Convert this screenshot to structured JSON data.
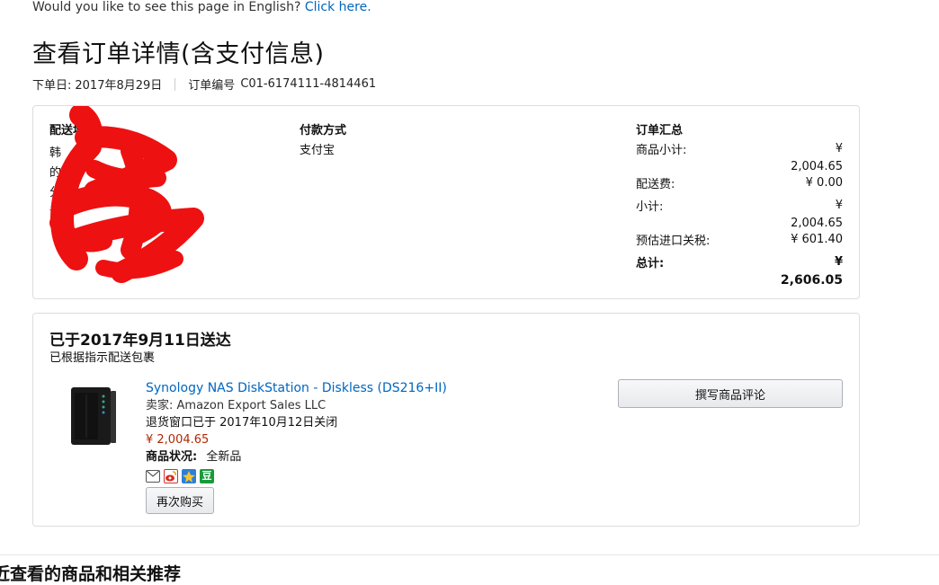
{
  "lang_prompt": {
    "question": "Would you like to see this page in English?",
    "link": "Click here."
  },
  "page_title": "查看订单详情(含支付信息)",
  "order_meta": {
    "date_label": "下单日:",
    "date": "2017年8月29日",
    "order_no_label": "订单编号",
    "order_no": "C01-6174111-4814461"
  },
  "shipping": {
    "title": "配送地",
    "lines": [
      "韩",
      "",
      "",
      "",
      "的",
      "分证",
      "证"
    ]
  },
  "payment": {
    "title": "付款方式",
    "method": "支付宝"
  },
  "summary": {
    "title": "订单汇总",
    "rows": [
      {
        "label": "商品小计:",
        "value_line1": "¥",
        "value_line2": "2,004.65"
      },
      {
        "label": "配送费:",
        "value_line1": "¥ 0.00",
        "value_line2": ""
      },
      {
        "label": "小计:",
        "value_line1": "¥",
        "value_line2": "2,004.65"
      },
      {
        "label": "预估进口关税:",
        "value_line1": "¥ 601.40",
        "value_line2": ""
      },
      {
        "label": "总计:",
        "value_line1": "¥",
        "value_line2": "2,606.05"
      }
    ]
  },
  "delivery": {
    "title": "已于2017年9月11日送达",
    "subtitle": "已根据指示配送包裹"
  },
  "item": {
    "title": "Synology NAS DiskStation - Diskless (DS216+II)",
    "seller": "卖家: Amazon Export Sales LLC",
    "return_window": "退货窗口已于 2017年10月12日关闭",
    "price": "¥ 2,004.65",
    "condition_label": "商品状况:",
    "condition_value": "全新品",
    "rebuy_label": "再次购买",
    "share_icons": [
      "mail-icon",
      "weibo-icon",
      "qzone-icon",
      "douban-icon"
    ],
    "douban_glyph": "豆"
  },
  "review_button": "撰写商品评论",
  "bottom_heading": "近查看的商品和相关推荐",
  "colors": {
    "link": "#0066c0",
    "price": "#b12704",
    "redaction": "#ee1111"
  }
}
